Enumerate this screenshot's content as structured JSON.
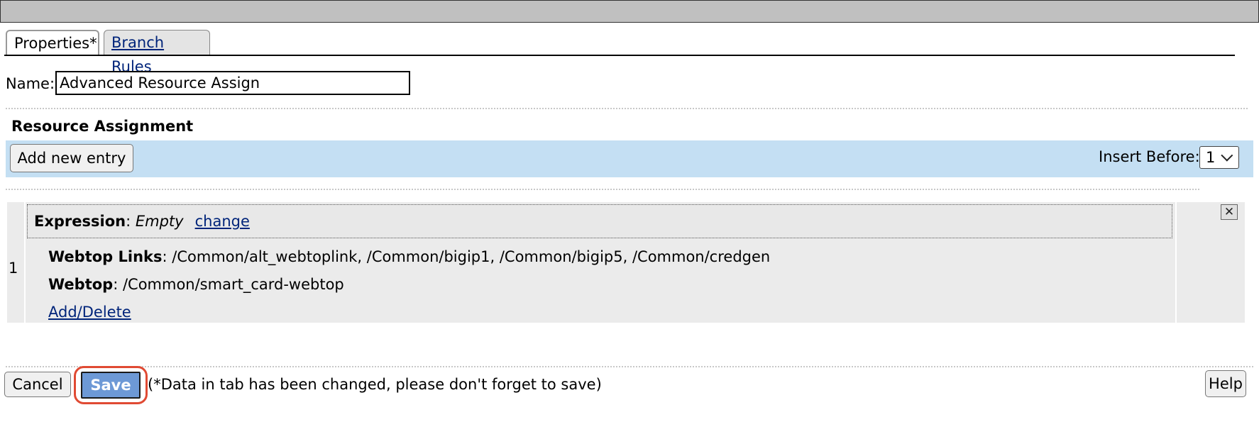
{
  "tabs": [
    {
      "label": "Properties*",
      "active": true
    },
    {
      "label": "Branch Rules",
      "active": false
    }
  ],
  "name_field": {
    "label": "Name:",
    "value": "Advanced Resource Assign"
  },
  "section": {
    "title": "Resource Assignment"
  },
  "toolbar": {
    "add_label": "Add new entry",
    "insert_before_label": "Insert Before:",
    "insert_before_value": "1"
  },
  "entry": {
    "row_number": "1",
    "expression_label": "Expression",
    "expression_value": "Empty",
    "change_label": "change",
    "webtop_links_label": "Webtop Links",
    "webtop_links_value": ": /Common/alt_webtoplink, /Common/bigip1, /Common/bigip5, /Common/credgen",
    "webtop_label": "Webtop",
    "webtop_value": ": /Common/smart_card-webtop",
    "add_delete_label": "Add/Delete",
    "close_icon": "close-icon"
  },
  "footer": {
    "cancel_label": "Cancel",
    "save_label": "Save",
    "save_note": "(*Data in tab has been changed, please don't forget to save)",
    "help_label": "Help"
  },
  "colors": {
    "toolbar_bg": "#c4dff3",
    "save_bg": "#6d99d6",
    "highlight": "#e04a33",
    "link": "#00247a"
  }
}
